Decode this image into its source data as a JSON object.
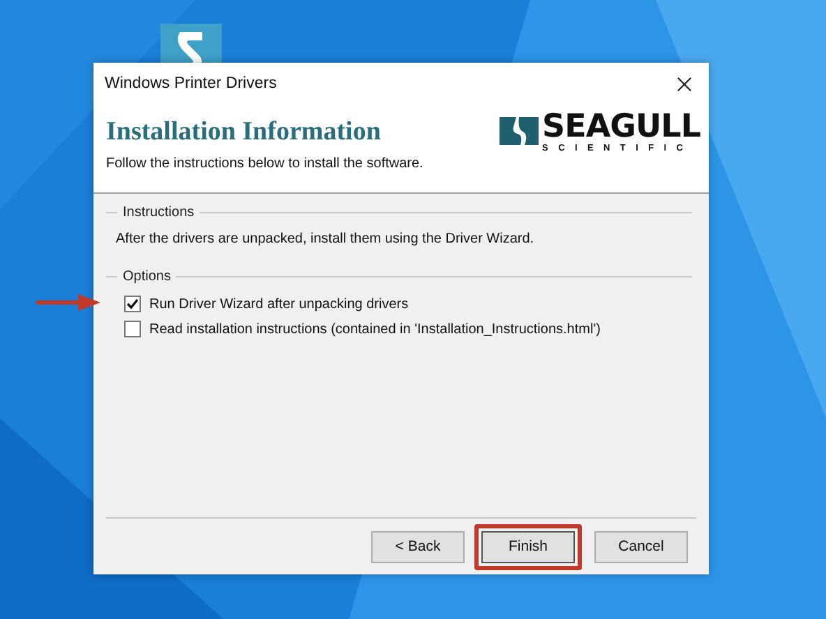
{
  "window": {
    "title": "Windows Printer Drivers"
  },
  "header": {
    "heading": "Installation Information",
    "subtitle": "Follow the instructions below to install the software.",
    "logo": {
      "name": "SEAGULL",
      "tagline": "SCIENTIFIC"
    }
  },
  "groups": [
    {
      "kind": "text",
      "label": "Instructions",
      "text": "After the drivers are unpacked, install them using the Driver Wizard."
    },
    {
      "kind": "options",
      "label": "Options",
      "options": [
        {
          "label": "Run Driver Wizard after unpacking drivers",
          "checked": true,
          "pointed": true
        },
        {
          "label": "Read installation instructions (contained in 'Installation_Instructions.html')",
          "checked": false,
          "pointed": false
        }
      ]
    }
  ],
  "buttons": [
    {
      "label": "< Back",
      "highlighted": false
    },
    {
      "label": "Finish",
      "highlighted": true
    },
    {
      "label": "Cancel",
      "highlighted": false
    }
  ]
}
